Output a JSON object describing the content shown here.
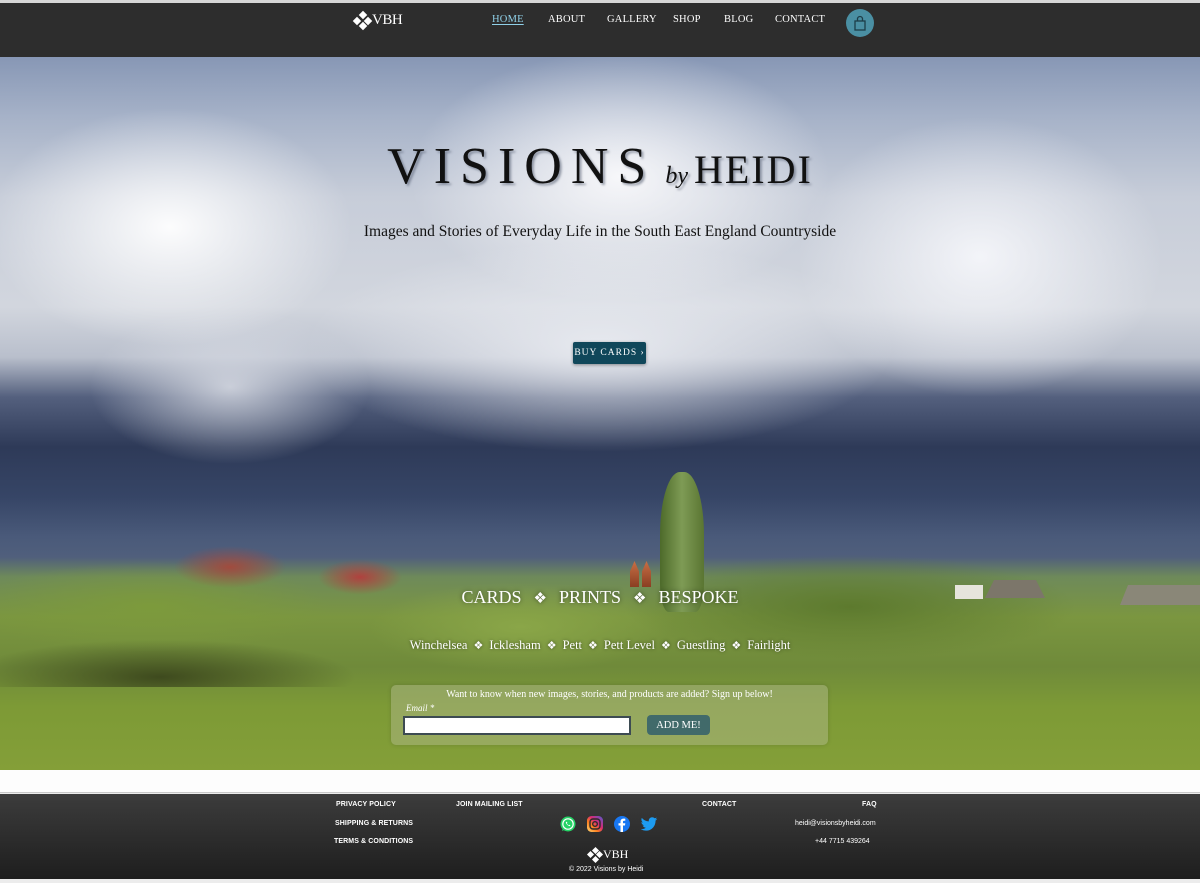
{
  "header": {
    "logo_text": "VBH",
    "nav": [
      {
        "label": "HOME",
        "active": true
      },
      {
        "label": "ABOUT",
        "active": false
      },
      {
        "label": "GALLERY",
        "active": false
      },
      {
        "label": "SHOP",
        "active": false
      },
      {
        "label": "BLOG",
        "active": false
      },
      {
        "label": "CONTACT",
        "active": false
      }
    ],
    "cart_icon": "shopping-bag-icon"
  },
  "hero": {
    "title_main": "VISIONS",
    "title_by": "by",
    "title_name": "HEIDI",
    "tagline": "Images and Stories of Everyday Life in the South East England Countryside",
    "buy_button_label": "BUY CARDS ›",
    "categories": [
      "CARDS",
      "PRINTS",
      "BESPOKE"
    ],
    "separator_glyph": "❖",
    "places": [
      "Winchelsea",
      "Icklesham",
      "Pett",
      "Pett Level",
      "Guestling",
      "Fairlight"
    ]
  },
  "signup": {
    "message": "Want to know when new images, stories, and products are added? Sign up below!",
    "email_label": "Email *",
    "email_value": "",
    "email_placeholder": "",
    "button_label": "ADD ME!"
  },
  "footer": {
    "links_left": [
      "PRIVACY POLICY",
      "SHIPPING & RETURNS",
      "TERMS & CONDITIONS"
    ],
    "join_mailing_list": "JOIN MAILING LIST",
    "contact": "CONTACT",
    "faq": "FAQ",
    "email": "heidi@visionsbyheidi.com",
    "phone": "+44  7715  439264",
    "socials": [
      "whatsapp",
      "instagram",
      "facebook",
      "twitter"
    ],
    "logo_text": "VBH",
    "copyright": "© 2022 Visions by Heidi"
  },
  "colors": {
    "header_bg": "#2d2d2d",
    "nav_active": "#8fd0e8",
    "cart_bg": "#4a8fa3",
    "buy_button_bg": "#10475a",
    "add_button_bg": "#416a6a",
    "whatsapp": "#25d366",
    "facebook": "#1877f2",
    "twitter": "#1d9bf0"
  }
}
